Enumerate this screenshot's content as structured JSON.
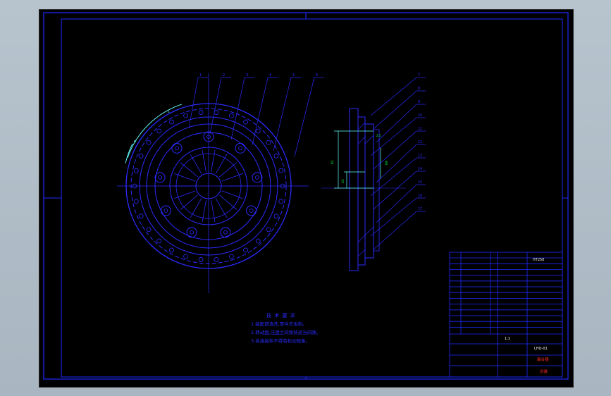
{
  "drawing": {
    "colors": {
      "background": "#000000",
      "frame": "#1e2aff",
      "center_lines": "#2b2bff",
      "dimension": "#66ffff",
      "dim_labels": "#00ff40",
      "title_text": "#ffffff",
      "highlight": "#ff2a2a"
    },
    "front_view_balloons": [
      "1",
      "2",
      "3",
      "4",
      "5",
      "6"
    ],
    "side_view_balloons": [
      "7",
      "8",
      "9",
      "10",
      "11",
      "12",
      "13",
      "14",
      "15",
      "16",
      "17"
    ],
    "dimensions": {
      "arc_label": "c",
      "arc_label_2": "e",
      "vertical_1": "61",
      "vertical_2": "41",
      "vertical_3": "69",
      "gap": "2.5"
    }
  },
  "technical_requirements": {
    "title": "技 术 要 求",
    "items": [
      "1.装配前清洗,零件去毛刺。",
      "2.转动盘,压盘之间保持适当间隙。",
      "3.各连接件不得有松动现象。"
    ]
  },
  "title_block": {
    "material": "HT250",
    "scale": "1:1",
    "drawing_name": "离合器",
    "drawing_number": "LHQ-01",
    "stamp": "总装"
  }
}
